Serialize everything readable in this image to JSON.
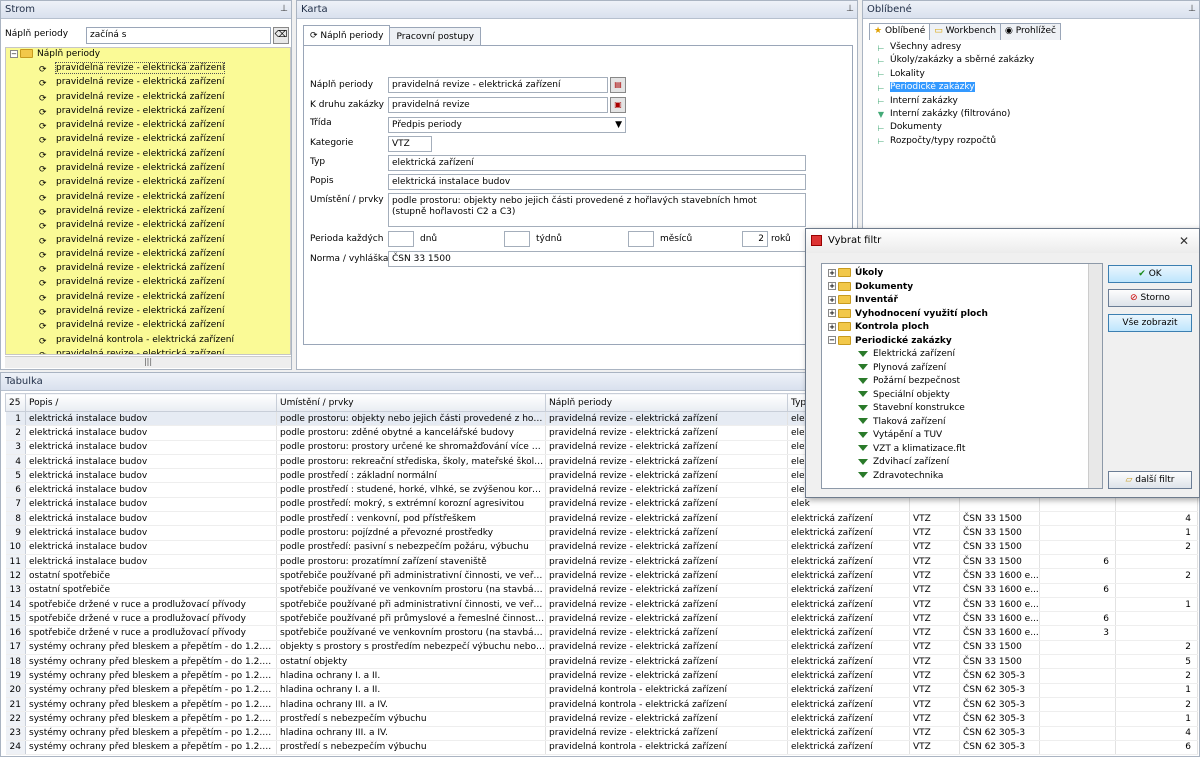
{
  "strom": {
    "title": "Strom",
    "filter_label": "Náplň periody",
    "filter_value": "začíná s",
    "root_label": "Náplň periody",
    "items": [
      "pravidelná revize - elektrická zařízení",
      "pravidelná revize - elektrická zařízení",
      "pravidelná revize - elektrická zařízení",
      "pravidelná revize - elektrická zařízení",
      "pravidelná revize - elektrická zařízení",
      "pravidelná revize - elektrická zařízení",
      "pravidelná revize - elektrická zařízení",
      "pravidelná revize - elektrická zařízení",
      "pravidelná revize - elektrická zařízení",
      "pravidelná revize - elektrická zařízení",
      "pravidelná revize - elektrická zařízení",
      "pravidelná revize - elektrická zařízení",
      "pravidelná revize - elektrická zařízení",
      "pravidelná revize - elektrická zařízení",
      "pravidelná revize - elektrická zařízení",
      "pravidelná revize - elektrická zařízení",
      "pravidelná revize - elektrická zařízení",
      "pravidelná revize - elektrická zařízení",
      "pravidelná revize - elektrická zařízení",
      "pravidelná kontrola - elektrická zařízení",
      "pravidelná revize - elektrická zařízení"
    ]
  },
  "karta": {
    "title": "Karta",
    "tab1": "Náplň periody",
    "tab2": "Pracovní postupy",
    "naplen_label": "Náplň periody",
    "naplen_value": "pravidelná revize - elektrická zařízení",
    "druh_label": "K druhu zakázky",
    "druh_value": "pravidelná revize",
    "trida_label": "Třída",
    "trida_value": "Předpis periody",
    "kategorie_label": "Kategorie",
    "kategorie_value": "VTZ",
    "typ_label": "Typ",
    "typ_value": "elektrická zařízení",
    "popis_label": "Popis",
    "popis_value": "elektrická instalace budov",
    "umisteni_label": "Umístění / prvky",
    "umisteni_value": "podle prostoru: objekty nebo jejich části provedené z hořlavých stavebních hmot (stupně hořlavosti C2 a C3)",
    "perioda_label": "Perioda každých",
    "dnu": "dnů",
    "tydnu": "týdnů",
    "mesicu": "měsíců",
    "roku_value": "2",
    "roku": "roků",
    "norma_label": "Norma / vyhláška",
    "norma_value": "ČSN 33 1500"
  },
  "oblibene": {
    "title": "Oblíbené",
    "tabs": [
      "Oblíbené",
      "Workbench",
      "Prohlížeč"
    ],
    "items": [
      "Všechny adresy",
      "Úkoly/zakázky a sběrné zakázky",
      "Lokality",
      "Periodické zakázky",
      "Interní zakázky",
      "Interní zakázky (filtrováno)",
      "Dokumenty",
      "Rozpočty/typy rozpočtů"
    ]
  },
  "tabulka": {
    "title": "Tabulka",
    "count": "25",
    "headers": [
      "Popis",
      "Umístění / prvky",
      "Náplň periody",
      "Typ"
    ],
    "rows": [
      [
        "1",
        "elektrická instalace budov",
        "podle prostoru: objekty nebo jejich části provedené z hořlavých...",
        "pravidelná revize - elektrická zařízení",
        "elek",
        "",
        "",
        "",
        ""
      ],
      [
        "2",
        "elektrická instalace budov",
        "podle prostoru: zděné obytné a kancelářské budovy",
        "pravidelná revize - elektrická zařízení",
        "elek",
        "",
        "",
        "",
        ""
      ],
      [
        "3",
        "elektrická instalace budov",
        "podle prostoru: prostory určené ke shromažďování více než 2...",
        "pravidelná revize - elektrická zařízení",
        "elek",
        "",
        "",
        "",
        ""
      ],
      [
        "4",
        "elektrická instalace budov",
        "podle prostoru: rekreační střediska, školy, mateřské školy, jesl...",
        "pravidelná revize - elektrická zařízení",
        "elek",
        "",
        "",
        "",
        ""
      ],
      [
        "5",
        "elektrická instalace budov",
        "podle prostředí : základní normální",
        "pravidelná revize - elektrická zařízení",
        "elek",
        "",
        "",
        "",
        ""
      ],
      [
        "6",
        "elektrická instalace budov",
        "podle prostředí : studené, horké, vlhké, se zvýšenou korozní a...",
        "pravidelná revize - elektrická zařízení",
        "elek",
        "",
        "",
        "",
        ""
      ],
      [
        "7",
        "elektrická instalace budov",
        "podle prostředí: mokrý, s extrémní korozní agresivitou",
        "pravidelná revize - elektrická zařízení",
        "elek",
        "",
        "",
        "",
        ""
      ],
      [
        "8",
        "elektrická instalace budov",
        "podle prostředí : venkovní, pod přístřeškem",
        "pravidelná revize - elektrická zařízení",
        "elektrická zařízení",
        "VTZ",
        "ČSN 33 1500",
        "",
        "4"
      ],
      [
        "9",
        "elektrická instalace budov",
        "podle prostoru: pojízdné a převozné prostředky",
        "pravidelná revize - elektrická zařízení",
        "elektrická zařízení",
        "VTZ",
        "ČSN 33 1500",
        "",
        "1"
      ],
      [
        "10",
        "elektrická instalace budov",
        "podle prostředí: pasivní s nebezpečím požáru, výbuchu",
        "pravidelná revize - elektrická zařízení",
        "elektrická zařízení",
        "VTZ",
        "ČSN 33 1500",
        "",
        "2"
      ],
      [
        "11",
        "elektrická instalace budov",
        "podle prostoru: prozatímní zařízení staveniště",
        "pravidelná revize - elektrická zařízení",
        "elektrická zařízení",
        "VTZ",
        "ČSN 33 1500",
        "6",
        ""
      ],
      [
        "12",
        "ostatní spotřebiče",
        "spotřebiče používané při administrativní činnosti, ve veřejné p...",
        "pravidelná revize - elektrická zařízení",
        "elektrická zařízení",
        "VTZ",
        "ČSN 33 1600 e...",
        "",
        "2"
      ],
      [
        "13",
        "ostatní spotřebiče",
        "spotřebiče používané ve venkovním prostoru (na stavbách, př...",
        "pravidelná revize - elektrická zařízení",
        "elektrická zařízení",
        "VTZ",
        "ČSN 33 1600 e...",
        "6",
        ""
      ],
      [
        "14",
        "spotřebiče držené v ruce a prodlužovací přívody",
        "spotřebiče používané při administrativní činnosti, ve veřejné p...",
        "pravidelná revize - elektrická zařízení",
        "elektrická zařízení",
        "VTZ",
        "ČSN 33 1600 e...",
        "",
        "1"
      ],
      [
        "15",
        "spotřebiče držené v ruce a prodlužovací přívody",
        "spotřebiče používané při průmyslové a řemeslné činnosti ve v...",
        "pravidelná revize - elektrická zařízení",
        "elektrická zařízení",
        "VTZ",
        "ČSN 33 1600 e...",
        "6",
        ""
      ],
      [
        "16",
        "spotřebiče držené v ruce a prodlužovací přívody",
        "spotřebiče používané ve venkovním prostoru (na stavbách, př...",
        "pravidelná revize - elektrická zařízení",
        "elektrická zařízení",
        "VTZ",
        "ČSN 33 1600 e...",
        "3",
        ""
      ],
      [
        "17",
        "systémy ochrany před bleskem a přepětím - do 1.2.2009",
        "objekty s prostory s prostředím nebezpečí výbuchu nebo požár...",
        "pravidelná revize - elektrická zařízení",
        "elektrická zařízení",
        "VTZ",
        "ČSN 33 1500",
        "",
        "2"
      ],
      [
        "18",
        "systémy ochrany před bleskem a přepětím - do 1.2.2009",
        "ostatní objekty",
        "pravidelná revize - elektrická zařízení",
        "elektrická zařízení",
        "VTZ",
        "ČSN 33 1500",
        "",
        "5"
      ],
      [
        "19",
        "systémy ochrany před bleskem a přepětím - po 1.2.2009",
        "hladina ochrany I. a II.",
        "pravidelná revize - elektrická zařízení",
        "elektrická zařízení",
        "VTZ",
        "ČSN 62 305-3",
        "",
        "2"
      ],
      [
        "20",
        "systémy ochrany před bleskem a přepětím - po 1.2.2009",
        "hladina ochrany I. a II.",
        "pravidelná kontrola - elektrická zařízení",
        "elektrická zařízení",
        "VTZ",
        "ČSN 62 305-3",
        "",
        "1"
      ],
      [
        "21",
        "systémy ochrany před bleskem a přepětím - po 1.2.2009",
        "hladina ochrany III. a IV.",
        "pravidelná kontrola - elektrická zařízení",
        "elektrická zařízení",
        "VTZ",
        "ČSN 62 305-3",
        "",
        "2"
      ],
      [
        "22",
        "systémy ochrany před bleskem a přepětím - po 1.2.2009",
        "prostředí s nebezpečím výbuchu",
        "pravidelná revize - elektrická zařízení",
        "elektrická zařízení",
        "VTZ",
        "ČSN 62 305-3",
        "",
        "1"
      ],
      [
        "23",
        "systémy ochrany před bleskem a přepětím - po 1.2.2009",
        "hladina ochrany III. a IV.",
        "pravidelná revize - elektrická zařízení",
        "elektrická zařízení",
        "VTZ",
        "ČSN 62 305-3",
        "",
        "4"
      ],
      [
        "24",
        "systémy ochrany před bleskem a přepětím - po 1.2.2009",
        "prostředí s nebezpečím výbuchu",
        "pravidelná kontrola - elektrická zařízení",
        "elektrická zařízení",
        "VTZ",
        "ČSN 62 305-3",
        "",
        "6"
      ]
    ]
  },
  "dialog": {
    "title": "Vybrat filtr",
    "folders": [
      "Úkoly",
      "Dokumenty",
      "Inventář",
      "Vyhodnocení využití ploch",
      "Kontrola ploch",
      "Periodické zakázky"
    ],
    "filters": [
      "Elektrická zařízení",
      "Plynová zařízení",
      "Požární bezpečnost",
      "Speciální objekty",
      "Stavební konstrukce",
      "Tlaková zařízení",
      "Vytápění a TUV",
      "VZT a klimatizace.flt",
      "Zdvihací zařízení",
      "Zdravotechnika"
    ],
    "ok": "OK",
    "storno": "Storno",
    "vse": "Vše zobrazit",
    "dalsi": "další filtr"
  },
  "colors": {
    "tree_bg": "#fafa96",
    "selection": "#3399ff"
  }
}
